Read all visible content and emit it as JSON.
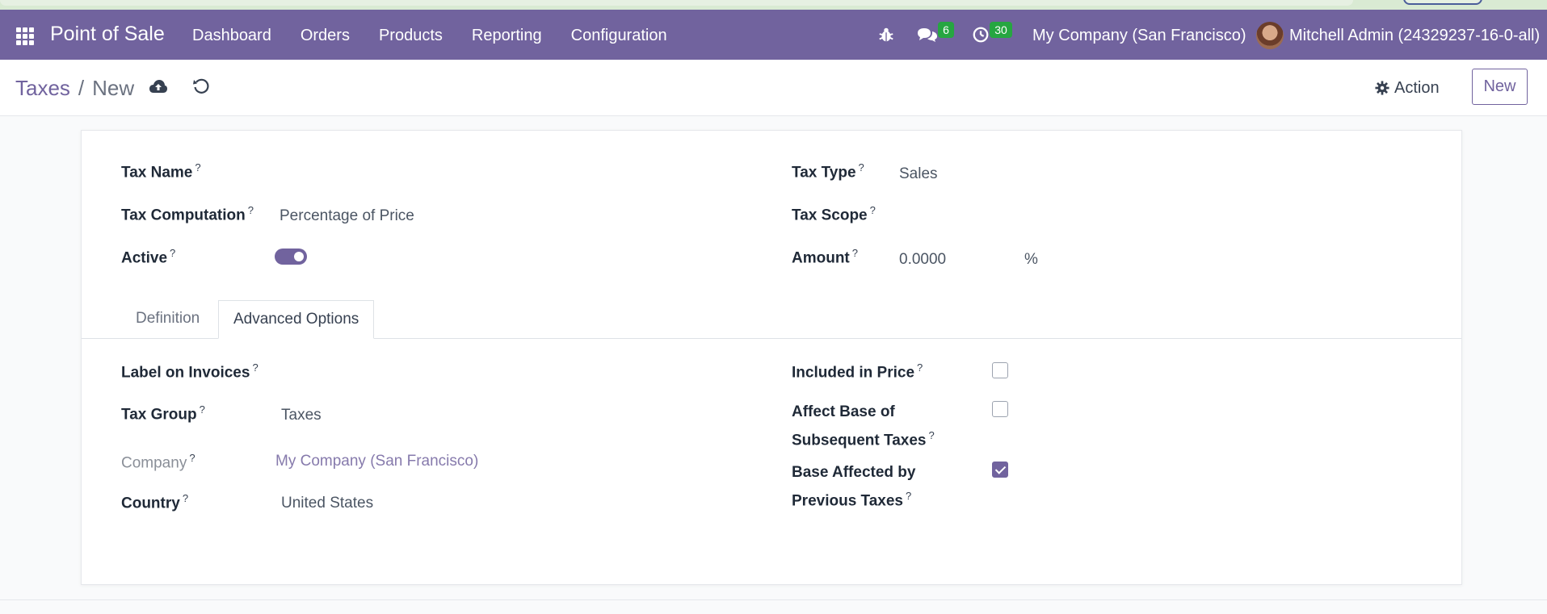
{
  "navbar": {
    "brand": "Point of Sale",
    "menu": [
      "Dashboard",
      "Orders",
      "Products",
      "Reporting",
      "Configuration"
    ],
    "chat_count": "6",
    "activity_count": "30",
    "company": "My Company (San Francisco)",
    "user": "Mitchell Admin (24329237-16-0-all)"
  },
  "control": {
    "breadcrumb_parent": "Taxes",
    "breadcrumb_separator": "/",
    "breadcrumb_current": "New",
    "action_label": "Action",
    "new_label": "New"
  },
  "form": {
    "tax_name_label": "Tax Name",
    "tax_computation_label": "Tax Computation",
    "tax_computation_value": "Percentage of Price",
    "active_label": "Active",
    "active": true,
    "tax_type_label": "Tax Type",
    "tax_type_value": "Sales",
    "tax_scope_label": "Tax Scope",
    "amount_label": "Amount",
    "amount_value": "0.0000",
    "amount_unit": "%",
    "help_mark": "?"
  },
  "tabs": [
    "Definition",
    "Advanced Options"
  ],
  "active_tab": "Advanced Options",
  "advanced": {
    "label_on_invoices_label": "Label on Invoices",
    "tax_group_label": "Tax Group",
    "tax_group_value": "Taxes",
    "company_label": "Company",
    "company_value": "My Company (San Francisco)",
    "country_label": "Country",
    "country_value": "United States",
    "included_in_price_label": "Included in Price",
    "included_in_price": false,
    "affect_base_label_1": "Affect Base of",
    "affect_base_label_2": "Subsequent Taxes",
    "affect_base": false,
    "base_affected_label_1": "Base Affected by",
    "base_affected_label_2": "Previous Taxes",
    "base_affected": true
  },
  "colors": {
    "brand": "#71639e",
    "badge": "#26a641"
  }
}
